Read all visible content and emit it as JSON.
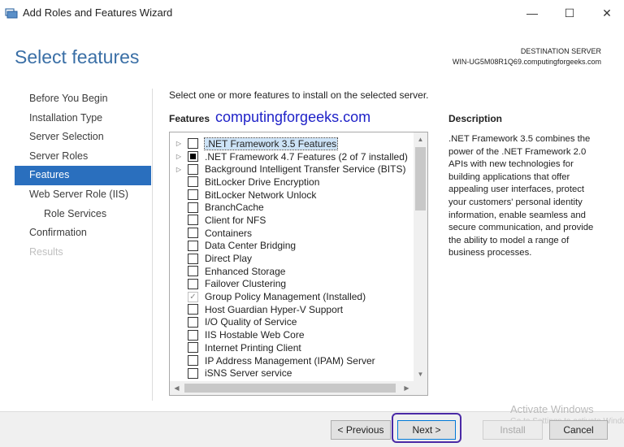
{
  "window": {
    "title": "Add Roles and Features Wizard",
    "controls": {
      "minimize": "—",
      "maximize": "☐",
      "close": "✕"
    },
    "icon": "server-manager-icon"
  },
  "header": {
    "page_title": "Select features",
    "destination_label": "DESTINATION SERVER",
    "destination_server": "WIN-UG5M08R1Q69.computingforgeeks.com"
  },
  "nav": {
    "items": [
      {
        "label": "Before You Begin",
        "state": "normal"
      },
      {
        "label": "Installation Type",
        "state": "normal"
      },
      {
        "label": "Server Selection",
        "state": "normal"
      },
      {
        "label": "Server Roles",
        "state": "normal"
      },
      {
        "label": "Features",
        "state": "active"
      },
      {
        "label": "Web Server Role (IIS)",
        "state": "normal"
      },
      {
        "label": "Role Services",
        "state": "normal"
      },
      {
        "label": "Confirmation",
        "state": "normal"
      },
      {
        "label": "Results",
        "state": "disabled"
      }
    ]
  },
  "main": {
    "instruction": "Select one or more features to install on the selected server.",
    "features_heading": "Features",
    "watermark": "computingforgeeks.com",
    "features": [
      {
        "label": ".NET Framework 3.5 Features",
        "expandable": true,
        "check": "unchecked",
        "selected": true
      },
      {
        "label": ".NET Framework 4.7 Features (2 of 7 installed)",
        "expandable": true,
        "check": "partial",
        "selected": false
      },
      {
        "label": "Background Intelligent Transfer Service (BITS)",
        "expandable": true,
        "check": "unchecked",
        "selected": false
      },
      {
        "label": "BitLocker Drive Encryption",
        "expandable": false,
        "check": "unchecked",
        "selected": false
      },
      {
        "label": "BitLocker Network Unlock",
        "expandable": false,
        "check": "unchecked",
        "selected": false
      },
      {
        "label": "BranchCache",
        "expandable": false,
        "check": "unchecked",
        "selected": false
      },
      {
        "label": "Client for NFS",
        "expandable": false,
        "check": "unchecked",
        "selected": false
      },
      {
        "label": "Containers",
        "expandable": false,
        "check": "unchecked",
        "selected": false
      },
      {
        "label": "Data Center Bridging",
        "expandable": false,
        "check": "unchecked",
        "selected": false
      },
      {
        "label": "Direct Play",
        "expandable": false,
        "check": "unchecked",
        "selected": false
      },
      {
        "label": "Enhanced Storage",
        "expandable": false,
        "check": "unchecked",
        "selected": false
      },
      {
        "label": "Failover Clustering",
        "expandable": false,
        "check": "unchecked",
        "selected": false
      },
      {
        "label": "Group Policy Management (Installed)",
        "expandable": false,
        "check": "installed",
        "selected": false
      },
      {
        "label": "Host Guardian Hyper-V Support",
        "expandable": false,
        "check": "unchecked",
        "selected": false
      },
      {
        "label": "I/O Quality of Service",
        "expandable": false,
        "check": "unchecked",
        "selected": false
      },
      {
        "label": "IIS Hostable Web Core",
        "expandable": false,
        "check": "unchecked",
        "selected": false
      },
      {
        "label": "Internet Printing Client",
        "expandable": false,
        "check": "unchecked",
        "selected": false
      },
      {
        "label": "IP Address Management (IPAM) Server",
        "expandable": false,
        "check": "unchecked",
        "selected": false
      },
      {
        "label": "iSNS Server service",
        "expandable": false,
        "check": "unchecked",
        "selected": false
      }
    ]
  },
  "description": {
    "heading": "Description",
    "text": ".NET Framework 3.5 combines the power of the .NET Framework 2.0 APIs with new technologies for building applications that offer appealing user interfaces, protect your customers' personal identity information, enable seamless and secure communication, and provide the ability to model a range of business processes."
  },
  "footer": {
    "previous_label": "< Previous",
    "next_label": "Next >",
    "install_label": "Install",
    "cancel_label": "Cancel"
  },
  "activation": {
    "title": "Activate Windows",
    "subtitle": "Go to Settings to activate Windows."
  },
  "colors": {
    "accent": "#2a6fbe",
    "title_blue": "#3a6fa6",
    "watermark_blue": "#1f22c8",
    "highlight_purple": "#4b2aa6"
  }
}
